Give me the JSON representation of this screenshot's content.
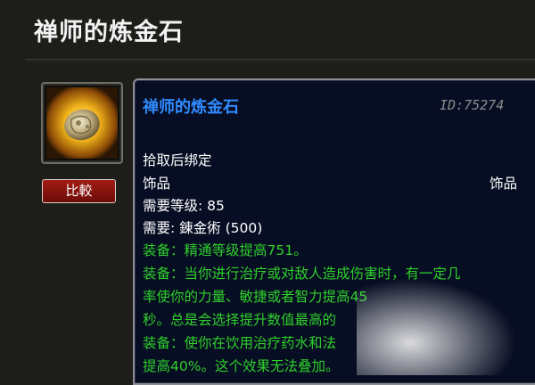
{
  "page": {
    "title": "禅师的炼金石"
  },
  "item": {
    "name": "禅师的炼金石",
    "id_label": "ID:75274",
    "binding": "拾取后绑定",
    "slot_left": "饰品",
    "slot_right": "饰品",
    "level_req": "需要等级: 85",
    "skill_req": "需要: 錬金術 (500)",
    "effects": [
      "装备：精通等级提高751。",
      "装备：当你进行治疗或对敌人造成伤害时，有一定几",
      "率使你的力量、敏捷或者智力提高45",
      "秒。总是会选择提升数值最高的",
      "装备：使你在饮用治疗药水和法",
      "提高40%。这个效果无法叠加。"
    ],
    "icon": "alchemist-stone-icon"
  },
  "compare_button": {
    "label": "比較"
  },
  "colors": {
    "item_name": "#2f8bff",
    "effect_text": "#2fd02c",
    "tooltip_bg": "#070d22",
    "compare_button": "#8a1610"
  }
}
